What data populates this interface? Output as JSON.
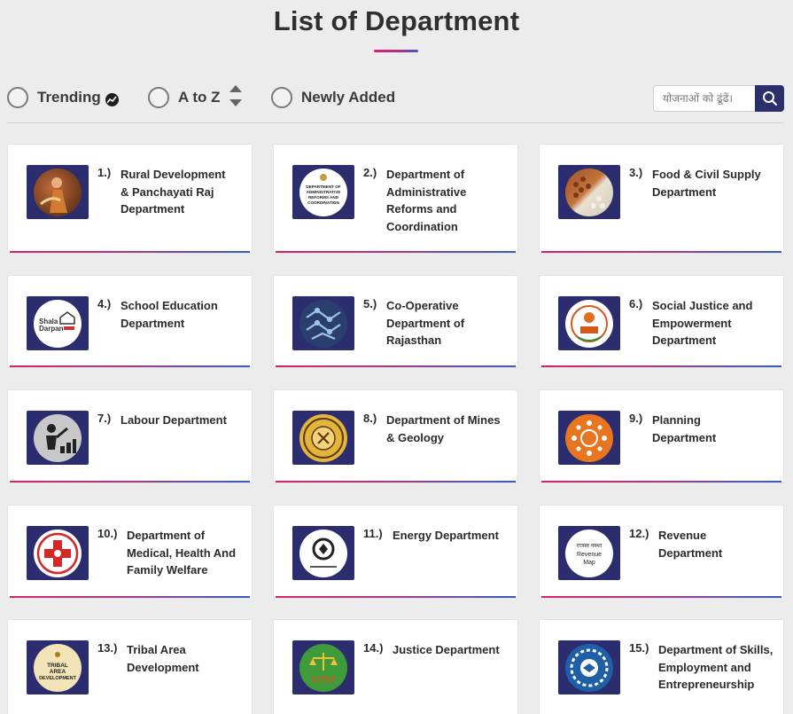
{
  "page": {
    "title": "List of Department"
  },
  "filters": {
    "trending": "Trending",
    "a_to_z": "A to Z",
    "newly_added": "Newly Added"
  },
  "search": {
    "placeholder": "योजनाओं को ढूंढें।"
  },
  "colors": {
    "accent_pink": "#d6236f",
    "accent_blue": "#3460c0",
    "logo_bg": "#2b2d6e"
  },
  "departments": [
    {
      "num": "1.)",
      "name": "Rural Development & Panchayati Raj Department",
      "icon": "rural-development-logo"
    },
    {
      "num": "2.)",
      "name": "Department of Administrative Reforms and Coordination",
      "icon": "administrative-reforms-logo",
      "logo_text": "DEPARTMENT OF ADMINISTRATIVE REFORMS AND COORDINATION"
    },
    {
      "num": "3.)",
      "name": "Food & Civil Supply Department",
      "icon": "food-supply-logo"
    },
    {
      "num": "4.)",
      "name": "School Education Department",
      "icon": "shala-darpan-logo",
      "logo_text": "Shala Darpan"
    },
    {
      "num": "5.)",
      "name": "Co-Operative Department of Rajasthan",
      "icon": "cooperative-logo"
    },
    {
      "num": "6.)",
      "name": "Social Justice and Empowerment Department",
      "icon": "social-justice-logo"
    },
    {
      "num": "7.)",
      "name": "Labour Department",
      "icon": "labour-logo"
    },
    {
      "num": "8.)",
      "name": "Department of Mines & Geology",
      "icon": "mines-geology-logo"
    },
    {
      "num": "9.)",
      "name": "Planning Department",
      "icon": "planning-logo"
    },
    {
      "num": "10.)",
      "name": "Department of Medical, Health And Family Welfare",
      "icon": "medical-health-logo"
    },
    {
      "num": "11.)",
      "name": "Energy Department",
      "icon": "energy-logo",
      "logo_text": "उर्जा"
    },
    {
      "num": "12.)",
      "name": "Revenue Department",
      "icon": "revenue-map-logo",
      "logo_text": "राजस्व नक्शा Revenue Map"
    },
    {
      "num": "13.)",
      "name": "Tribal Area Development",
      "icon": "tribal-area-logo",
      "logo_text": "TRIBAL AREA DEVELOPMENT"
    },
    {
      "num": "14.)",
      "name": "Justice Department",
      "icon": "justice-logo",
      "logo_text": "LITES"
    },
    {
      "num": "15.)",
      "name": "Department of Skills, Employment and Entrepreneurship",
      "icon": "skills-employment-logo"
    }
  ]
}
